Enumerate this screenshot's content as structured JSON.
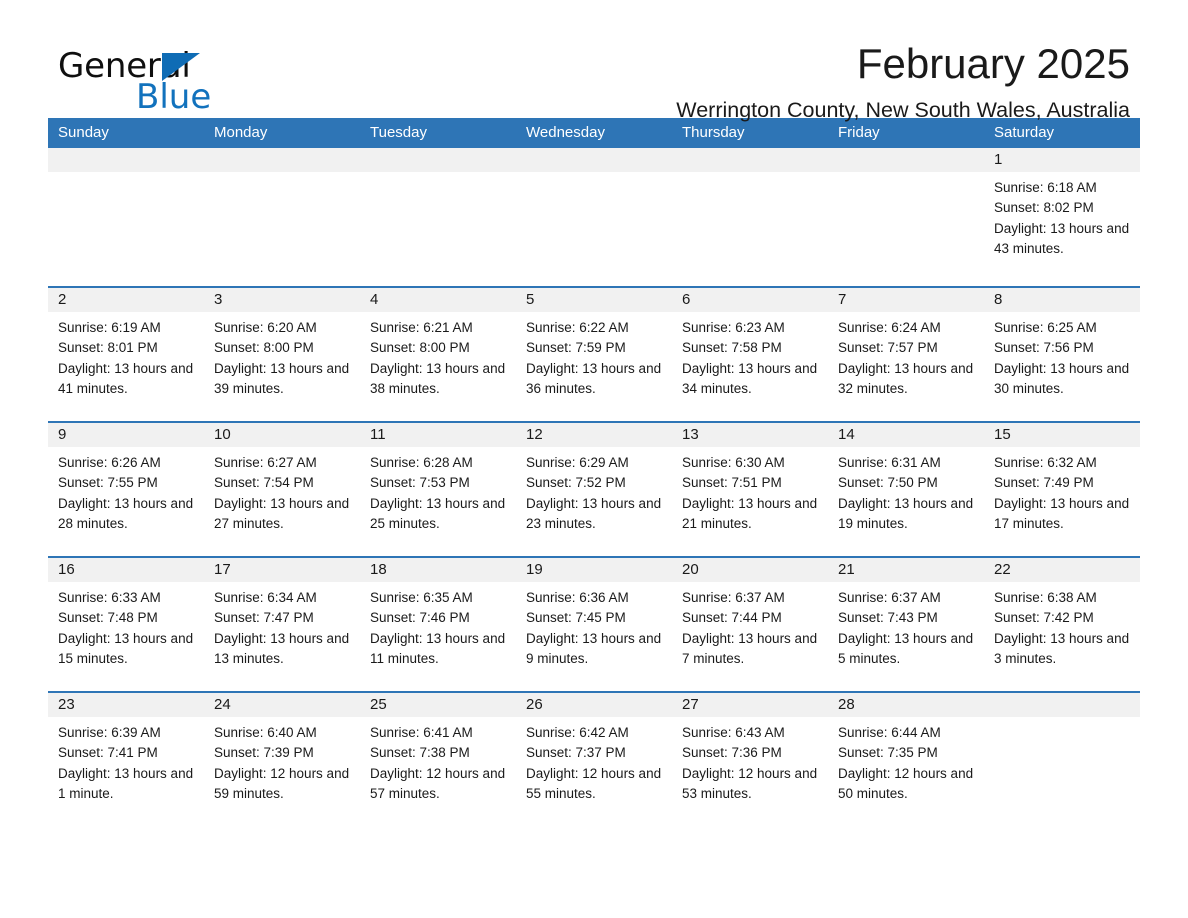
{
  "logo": {
    "word_one": "General",
    "word_two": "Blue",
    "triangle_color": "#0f6cb5",
    "blue_text_color": "#1272bd"
  },
  "header": {
    "title": "February 2025",
    "subtitle": "Werrington County, New South Wales, Australia"
  },
  "theme": {
    "header_blue": "#2e75b6",
    "daynum_strip": "#f1f1f1",
    "text": "#1a1a1a"
  },
  "calendar": {
    "weekdays": [
      "Sunday",
      "Monday",
      "Tuesday",
      "Wednesday",
      "Thursday",
      "Friday",
      "Saturday"
    ],
    "weeks": [
      [
        {
          "day": "",
          "sunrise": "",
          "sunset": "",
          "daylight": "",
          "empty": true
        },
        {
          "day": "",
          "sunrise": "",
          "sunset": "",
          "daylight": "",
          "empty": true
        },
        {
          "day": "",
          "sunrise": "",
          "sunset": "",
          "daylight": "",
          "empty": true
        },
        {
          "day": "",
          "sunrise": "",
          "sunset": "",
          "daylight": "",
          "empty": true
        },
        {
          "day": "",
          "sunrise": "",
          "sunset": "",
          "daylight": "",
          "empty": true
        },
        {
          "day": "",
          "sunrise": "",
          "sunset": "",
          "daylight": "",
          "empty": true
        },
        {
          "day": "1",
          "sunrise": "Sunrise: 6:18 AM",
          "sunset": "Sunset: 8:02 PM",
          "daylight": "Daylight: 13 hours and 43 minutes.",
          "empty": false
        }
      ],
      [
        {
          "day": "2",
          "sunrise": "Sunrise: 6:19 AM",
          "sunset": "Sunset: 8:01 PM",
          "daylight": "Daylight: 13 hours and 41 minutes.",
          "empty": false
        },
        {
          "day": "3",
          "sunrise": "Sunrise: 6:20 AM",
          "sunset": "Sunset: 8:00 PM",
          "daylight": "Daylight: 13 hours and 39 minutes.",
          "empty": false
        },
        {
          "day": "4",
          "sunrise": "Sunrise: 6:21 AM",
          "sunset": "Sunset: 8:00 PM",
          "daylight": "Daylight: 13 hours and 38 minutes.",
          "empty": false
        },
        {
          "day": "5",
          "sunrise": "Sunrise: 6:22 AM",
          "sunset": "Sunset: 7:59 PM",
          "daylight": "Daylight: 13 hours and 36 minutes.",
          "empty": false
        },
        {
          "day": "6",
          "sunrise": "Sunrise: 6:23 AM",
          "sunset": "Sunset: 7:58 PM",
          "daylight": "Daylight: 13 hours and 34 minutes.",
          "empty": false
        },
        {
          "day": "7",
          "sunrise": "Sunrise: 6:24 AM",
          "sunset": "Sunset: 7:57 PM",
          "daylight": "Daylight: 13 hours and 32 minutes.",
          "empty": false
        },
        {
          "day": "8",
          "sunrise": "Sunrise: 6:25 AM",
          "sunset": "Sunset: 7:56 PM",
          "daylight": "Daylight: 13 hours and 30 minutes.",
          "empty": false
        }
      ],
      [
        {
          "day": "9",
          "sunrise": "Sunrise: 6:26 AM",
          "sunset": "Sunset: 7:55 PM",
          "daylight": "Daylight: 13 hours and 28 minutes.",
          "empty": false
        },
        {
          "day": "10",
          "sunrise": "Sunrise: 6:27 AM",
          "sunset": "Sunset: 7:54 PM",
          "daylight": "Daylight: 13 hours and 27 minutes.",
          "empty": false
        },
        {
          "day": "11",
          "sunrise": "Sunrise: 6:28 AM",
          "sunset": "Sunset: 7:53 PM",
          "daylight": "Daylight: 13 hours and 25 minutes.",
          "empty": false
        },
        {
          "day": "12",
          "sunrise": "Sunrise: 6:29 AM",
          "sunset": "Sunset: 7:52 PM",
          "daylight": "Daylight: 13 hours and 23 minutes.",
          "empty": false
        },
        {
          "day": "13",
          "sunrise": "Sunrise: 6:30 AM",
          "sunset": "Sunset: 7:51 PM",
          "daylight": "Daylight: 13 hours and 21 minutes.",
          "empty": false
        },
        {
          "day": "14",
          "sunrise": "Sunrise: 6:31 AM",
          "sunset": "Sunset: 7:50 PM",
          "daylight": "Daylight: 13 hours and 19 minutes.",
          "empty": false
        },
        {
          "day": "15",
          "sunrise": "Sunrise: 6:32 AM",
          "sunset": "Sunset: 7:49 PM",
          "daylight": "Daylight: 13 hours and 17 minutes.",
          "empty": false
        }
      ],
      [
        {
          "day": "16",
          "sunrise": "Sunrise: 6:33 AM",
          "sunset": "Sunset: 7:48 PM",
          "daylight": "Daylight: 13 hours and 15 minutes.",
          "empty": false
        },
        {
          "day": "17",
          "sunrise": "Sunrise: 6:34 AM",
          "sunset": "Sunset: 7:47 PM",
          "daylight": "Daylight: 13 hours and 13 minutes.",
          "empty": false
        },
        {
          "day": "18",
          "sunrise": "Sunrise: 6:35 AM",
          "sunset": "Sunset: 7:46 PM",
          "daylight": "Daylight: 13 hours and 11 minutes.",
          "empty": false
        },
        {
          "day": "19",
          "sunrise": "Sunrise: 6:36 AM",
          "sunset": "Sunset: 7:45 PM",
          "daylight": "Daylight: 13 hours and 9 minutes.",
          "empty": false
        },
        {
          "day": "20",
          "sunrise": "Sunrise: 6:37 AM",
          "sunset": "Sunset: 7:44 PM",
          "daylight": "Daylight: 13 hours and 7 minutes.",
          "empty": false
        },
        {
          "day": "21",
          "sunrise": "Sunrise: 6:37 AM",
          "sunset": "Sunset: 7:43 PM",
          "daylight": "Daylight: 13 hours and 5 minutes.",
          "empty": false
        },
        {
          "day": "22",
          "sunrise": "Sunrise: 6:38 AM",
          "sunset": "Sunset: 7:42 PM",
          "daylight": "Daylight: 13 hours and 3 minutes.",
          "empty": false
        }
      ],
      [
        {
          "day": "23",
          "sunrise": "Sunrise: 6:39 AM",
          "sunset": "Sunset: 7:41 PM",
          "daylight": "Daylight: 13 hours and 1 minute.",
          "empty": false
        },
        {
          "day": "24",
          "sunrise": "Sunrise: 6:40 AM",
          "sunset": "Sunset: 7:39 PM",
          "daylight": "Daylight: 12 hours and 59 minutes.",
          "empty": false
        },
        {
          "day": "25",
          "sunrise": "Sunrise: 6:41 AM",
          "sunset": "Sunset: 7:38 PM",
          "daylight": "Daylight: 12 hours and 57 minutes.",
          "empty": false
        },
        {
          "day": "26",
          "sunrise": "Sunrise: 6:42 AM",
          "sunset": "Sunset: 7:37 PM",
          "daylight": "Daylight: 12 hours and 55 minutes.",
          "empty": false
        },
        {
          "day": "27",
          "sunrise": "Sunrise: 6:43 AM",
          "sunset": "Sunset: 7:36 PM",
          "daylight": "Daylight: 12 hours and 53 minutes.",
          "empty": false
        },
        {
          "day": "28",
          "sunrise": "Sunrise: 6:44 AM",
          "sunset": "Sunset: 7:35 PM",
          "daylight": "Daylight: 12 hours and 50 minutes.",
          "empty": false
        },
        {
          "day": "",
          "sunrise": "",
          "sunset": "",
          "daylight": "",
          "empty": true
        }
      ]
    ]
  }
}
